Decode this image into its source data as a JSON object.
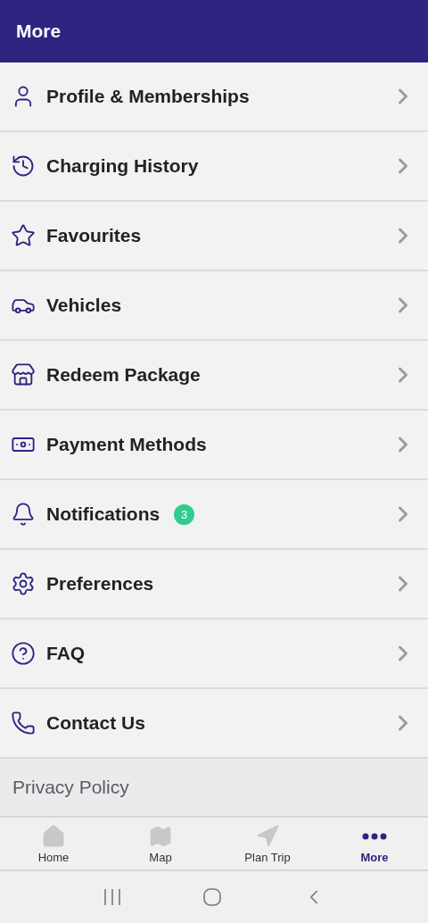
{
  "header": {
    "title": "More"
  },
  "menu": [
    {
      "label": "Profile & Memberships"
    },
    {
      "label": "Charging History"
    },
    {
      "label": "Favourites"
    },
    {
      "label": "Vehicles"
    },
    {
      "label": "Redeem Package"
    },
    {
      "label": "Payment Methods"
    },
    {
      "label": "Notifications",
      "badge": "3"
    },
    {
      "label": "Preferences"
    },
    {
      "label": "FAQ"
    },
    {
      "label": "Contact Us"
    }
  ],
  "footer_link": "Privacy Policy",
  "tabs": [
    {
      "label": "Home",
      "selected": false
    },
    {
      "label": "Map",
      "selected": false
    },
    {
      "label": "Plan Trip",
      "selected": false
    },
    {
      "label": "More",
      "selected": true
    }
  ]
}
